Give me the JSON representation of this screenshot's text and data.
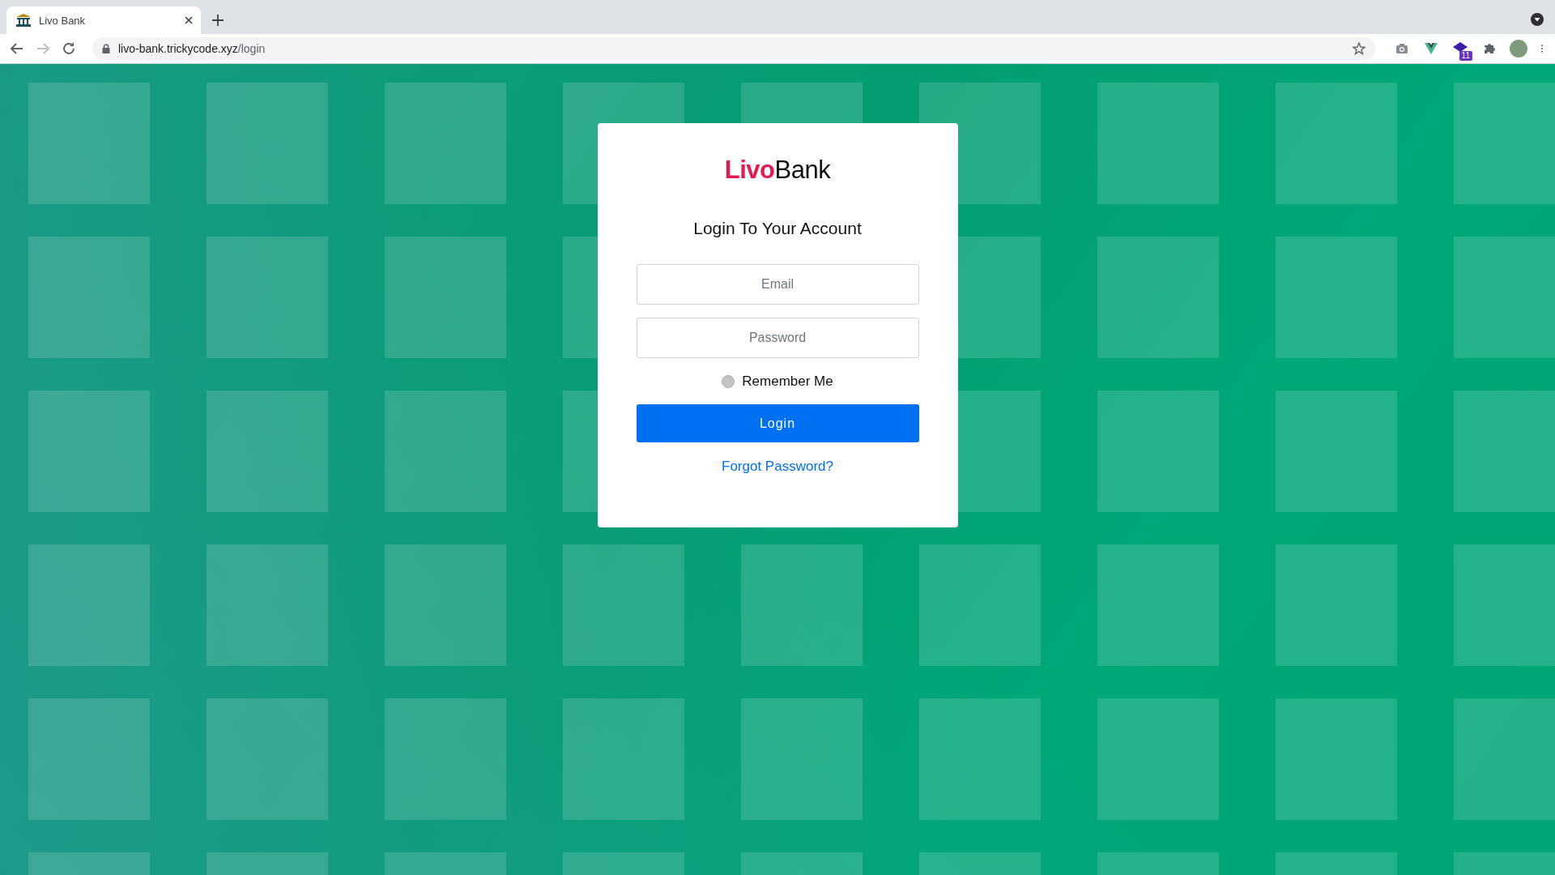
{
  "browser": {
    "tabs": [
      {
        "title": "Livo Bank",
        "selected": true
      }
    ],
    "forward_disabled": true,
    "address": {
      "host": "livo-bank.trickycode.xyz",
      "path": "/login"
    },
    "extension_badge": "11"
  },
  "card": {
    "logo": {
      "brand": "Livo",
      "rest": "Bank"
    },
    "title": "Login To Your Account",
    "fields": [
      {
        "placeholder": "Email"
      },
      {
        "placeholder": "Password"
      }
    ],
    "remember": {
      "label": "Remember Me",
      "checked": false
    },
    "submit": "Login",
    "forgot": "Forgot Password?"
  }
}
